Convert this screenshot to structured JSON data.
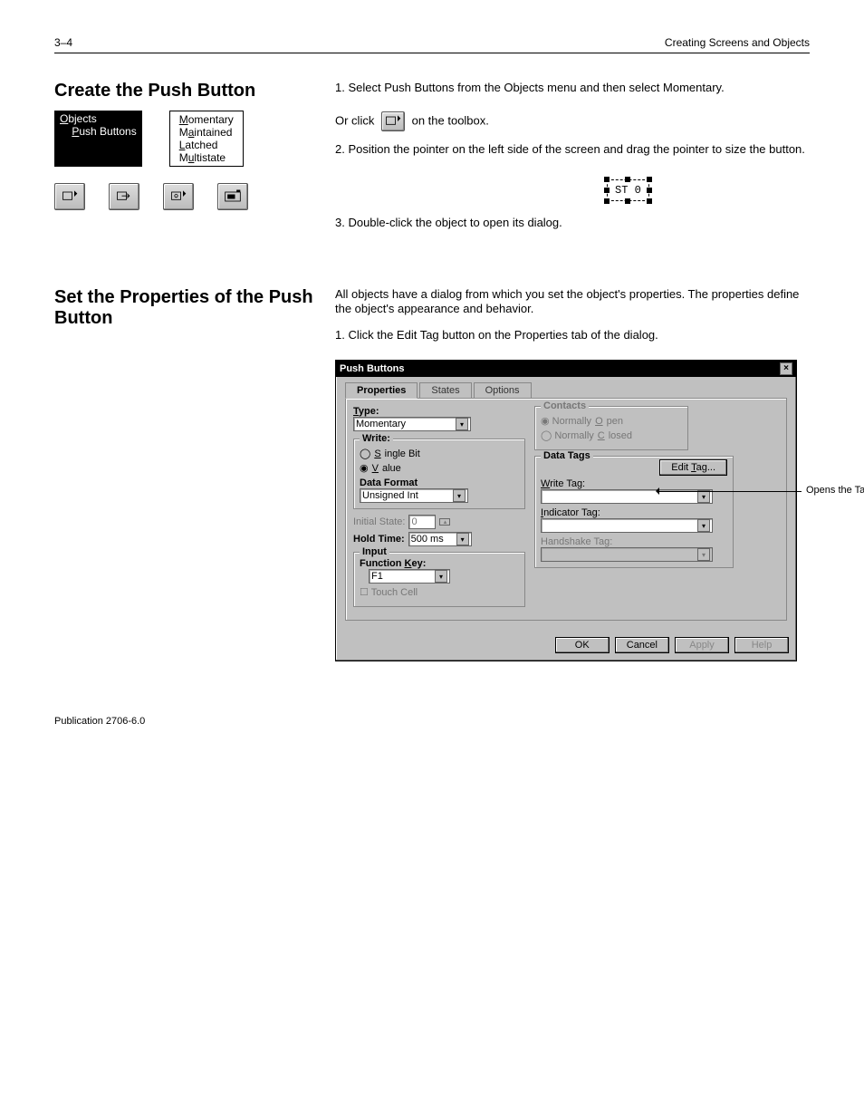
{
  "header": {
    "left": "3–4",
    "right": "Creating Screens and Objects"
  },
  "intro": {
    "heading": "Create the Push Button",
    "p1_a": "1. Select Push Buttons from the Objects menu and then select Momentary.",
    "p1_icon_note": "Or click",
    "p1_b": "on the toolbox.",
    "p2": "2. Position the pointer on the left side of the screen and drag the pointer to size the button.",
    "p3": "3. Double-click the object to open its dialog.",
    "boxtext": "ST 0"
  },
  "menu": {
    "top": "Objects",
    "sub": "Push Buttons",
    "items": [
      "Momentary",
      "Maintained",
      "Latched",
      "Multistate"
    ]
  },
  "toolbar_icons": [
    "momentary-icon",
    "maintained-icon",
    "latched-icon",
    "multistate-icon"
  ],
  "section2": {
    "heading": "Set the Properties of the Push Button",
    "para": "All objects have a dialog from which you set the object's properties. The properties define the object's appearance and behavior.",
    "step": "1. Click the Edit Tag button on the Properties tab of the dialog."
  },
  "dialog": {
    "title": "Push Buttons",
    "tabs": [
      "Properties",
      "States",
      "Options"
    ],
    "type_label": "Type:",
    "type_value": "Momentary",
    "write_label": "Write:",
    "write_opts": [
      "Single Bit",
      "Value"
    ],
    "dataformat_label": "Data Format",
    "dataformat_value": "Unsigned Int",
    "initial_label": "Initial State:",
    "initial_value": "0",
    "hold_label": "Hold Time:",
    "hold_value": "500 ms",
    "input_label": "Input",
    "funckey_label": "Function Key:",
    "funckey_value": "F1",
    "touchcell_label": "Touch Cell",
    "contacts_label": "Contacts",
    "contacts_opts": [
      "Normally Open",
      "Normally Closed"
    ],
    "datatags_label": "Data Tags",
    "edittag_btn": "Edit Tag...",
    "writetag_label": "Write Tag:",
    "indicatortag_label": "Indicator Tag:",
    "handshaketag_label": "Handshake Tag:",
    "buttons": [
      "OK",
      "Cancel",
      "Apply",
      "Help"
    ],
    "callout": "Opens the Tag Editor"
  },
  "footer": "Publication 2706-6.0"
}
